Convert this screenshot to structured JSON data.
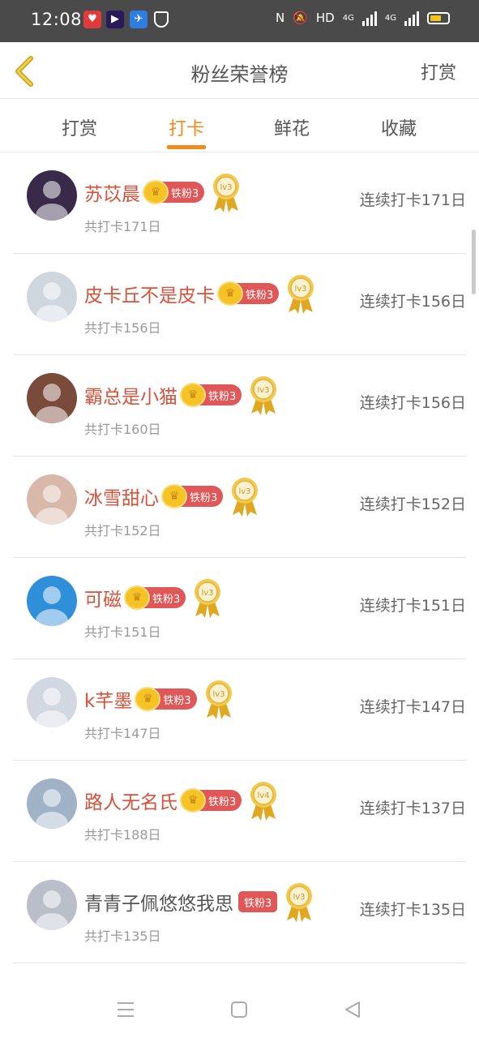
{
  "status_bar": {
    "time": "12:08",
    "apps": [
      "heart-app-icon",
      "video-app-icon",
      "travel-app-icon"
    ],
    "indicators": {
      "nfc": "N",
      "mute": "🔕",
      "hd": "HD",
      "net1": "4G",
      "net2": "4G"
    },
    "battery_color": "#f0c419"
  },
  "header": {
    "title": "粉丝荣誉榜",
    "action": "打赏",
    "back_icon": "chevron-left-icon"
  },
  "tabs": [
    {
      "label": "打赏",
      "active": false
    },
    {
      "label": "打卡",
      "active": true
    },
    {
      "label": "鲜花",
      "active": false
    },
    {
      "label": "收藏",
      "active": false
    }
  ],
  "accent_color": "#f28a1a",
  "list": [
    {
      "name": "苏苡晨",
      "badge": "铁粉3",
      "crown": true,
      "level": "lv3",
      "total": "共打卡171日",
      "streak": "连续打卡171日",
      "avatar_color": "#3a2a4a"
    },
    {
      "name": "皮卡丘不是皮卡",
      "badge": "铁粉3",
      "crown": true,
      "level": "lv3",
      "total": "共打卡156日",
      "streak": "连续打卡156日",
      "avatar_color": "#cfd6de"
    },
    {
      "name": "霸总是小猫",
      "badge": "铁粉3",
      "crown": true,
      "level": "lv3",
      "total": "共打卡160日",
      "streak": "连续打卡156日",
      "avatar_color": "#7a4a3a"
    },
    {
      "name": "冰雪甜心",
      "badge": "铁粉3",
      "crown": true,
      "level": "lv3",
      "total": "共打卡152日",
      "streak": "连续打卡152日",
      "avatar_color": "#d8b8a8"
    },
    {
      "name": "可磁",
      "badge": "铁粉3",
      "crown": true,
      "level": "lv3",
      "total": "共打卡151日",
      "streak": "连续打卡151日",
      "avatar_color": "#2f8fd8"
    },
    {
      "name": "k芊墨",
      "badge": "铁粉3",
      "crown": true,
      "level": "lv3",
      "total": "共打卡147日",
      "streak": "连续打卡147日",
      "avatar_color": "#d3d7e2"
    },
    {
      "name": "路人无名氏",
      "badge": "铁粉3",
      "crown": true,
      "level": "lv4",
      "total": "共打卡188日",
      "streak": "连续打卡137日",
      "avatar_color": "#9fb2c6"
    },
    {
      "name": "青青子佩悠悠我思",
      "badge": "铁粉3",
      "crown": false,
      "level": "lv3",
      "total": "共打卡135日",
      "streak": "连续打卡135日",
      "avatar_color": "#b9bec8"
    }
  ],
  "nav": [
    "menu-icon",
    "home-square-icon",
    "back-triangle-icon"
  ]
}
